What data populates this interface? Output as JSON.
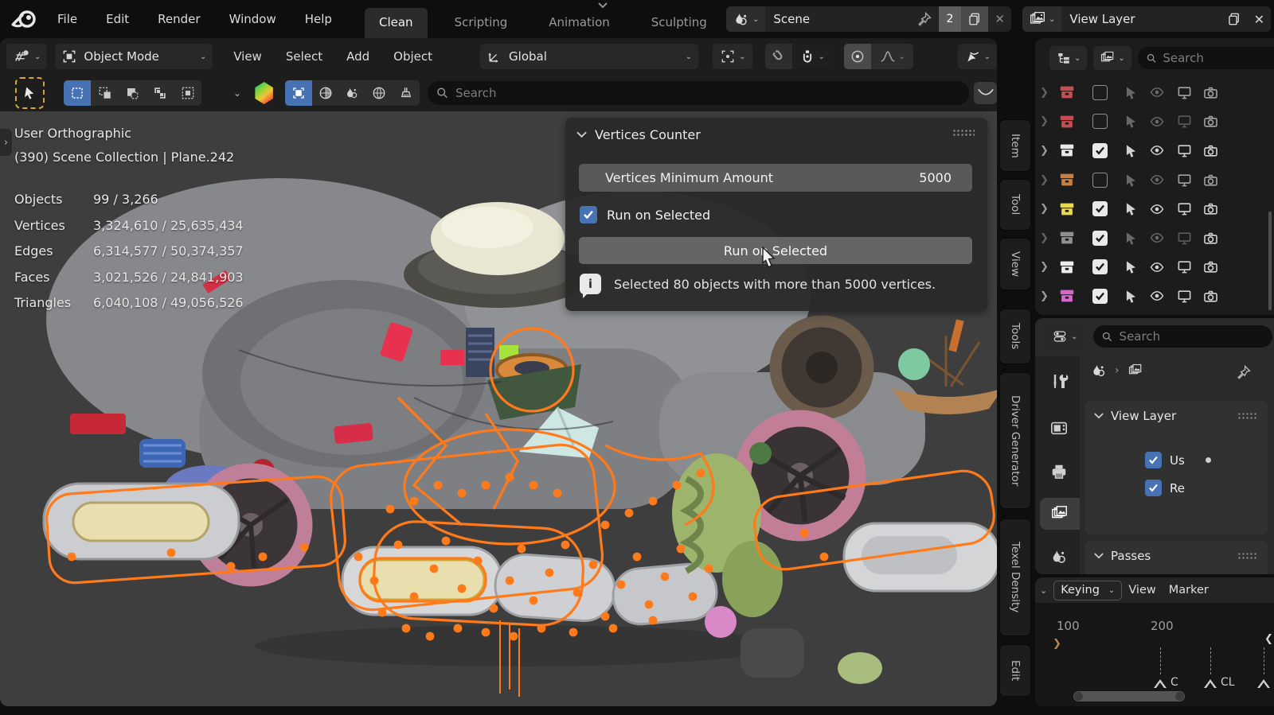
{
  "topbar": {
    "menus": [
      "File",
      "Edit",
      "Render",
      "Window",
      "Help"
    ],
    "workspaces": [
      {
        "label": "Clean",
        "active": true
      },
      {
        "label": "Scripting",
        "active": false
      },
      {
        "label": "Animation",
        "active": false
      },
      {
        "label": "Sculpting",
        "active": false
      }
    ],
    "scene_selector": {
      "value": "Scene",
      "users_badge": "2"
    },
    "view_layer_selector": {
      "value": "View Layer"
    }
  },
  "viewport": {
    "header": {
      "mode": "Object Mode",
      "menus": [
        "View",
        "Select",
        "Add",
        "Object"
      ],
      "orientation": "Global"
    },
    "tool_settings": {
      "search_placeholder": "Search"
    },
    "overlay": {
      "view_label": "User Orthographic",
      "context_label": "(390) Scene Collection | Plane.242",
      "stats": [
        {
          "label": "Objects",
          "value": "99 / 3,266"
        },
        {
          "label": "Vertices",
          "value": "3,324,610 / 25,635,434"
        },
        {
          "label": "Edges",
          "value": "6,314,577 / 50,374,357"
        },
        {
          "label": "Faces",
          "value": "3,021,526 / 24,841,903"
        },
        {
          "label": "Triangles",
          "value": "6,040,108 / 49,056,526"
        }
      ]
    },
    "vertices_counter_panel": {
      "title": "Vertices Counter",
      "min_amount_label": "Vertices Minimum Amount",
      "min_amount_value": "5000",
      "checkbox_label": "Run on Selected",
      "button_label": "Run on Selected",
      "info_message": "Selected 80 objects with more than 5000 vertices."
    },
    "sidebar_tabs": [
      "Item",
      "Tool",
      "View",
      "Tools",
      "Driver Generator",
      "Texel Density",
      "Edit"
    ]
  },
  "outliner": {
    "search_placeholder": "Search",
    "rows": [
      {
        "color": "#c24d52",
        "checked": false,
        "bright": false,
        "monitor_on": true,
        "camera_bright": false
      },
      {
        "color": "#c24d52",
        "checked": false,
        "bright": false,
        "monitor_on": false,
        "camera_bright": false
      },
      {
        "color": "#e8e8e8",
        "checked": true,
        "bright": true,
        "monitor_on": true,
        "camera_bright": true
      },
      {
        "color": "#c9803f",
        "checked": false,
        "bright": false,
        "monitor_on": true,
        "camera_bright": false
      },
      {
        "color": "#e8d94e",
        "checked": true,
        "bright": true,
        "monitor_on": true,
        "camera_bright": true
      },
      {
        "color": "#8f8f8f",
        "checked": true,
        "bright": false,
        "monitor_on": false,
        "camera_bright": true
      },
      {
        "color": "#ececec",
        "checked": true,
        "bright": true,
        "monitor_on": true,
        "camera_bright": true
      },
      {
        "color": "#d767cf",
        "checked": true,
        "bright": true,
        "monitor_on": true,
        "camera_bright": true
      }
    ]
  },
  "properties": {
    "search_placeholder": "Search",
    "tabs": [
      "tool",
      "render",
      "output",
      "view-layer",
      "scene"
    ],
    "active_tab": "view-layer",
    "view_layer_panel": {
      "title": "View Layer",
      "use_label": "Us",
      "render_label": "Re"
    },
    "passes_panel": {
      "title": "Passes"
    }
  },
  "timeline": {
    "keying_label": "Keying",
    "view_label": "View",
    "marker_label": "Marker",
    "frame_ticks": [
      "100",
      "200"
    ],
    "markers": [
      "C",
      "CL",
      ""
    ]
  },
  "icons": {
    "search": "magnifier",
    "close": "✕",
    "pin": "pushpin",
    "duplicate": "copy-pages",
    "dropdown": "⌄",
    "eye": "visibility",
    "monitor": "viewport-visibility",
    "camera": "render-visibility",
    "pointer": "selectability",
    "magnet": "snapping",
    "info": "i-bubble"
  },
  "colors": {
    "accent_blue": "#4772b3",
    "active_tool_outline": "#d9a335",
    "selection_orange": "#ff7a1a",
    "viewport_bg": "#3e3e3e"
  }
}
